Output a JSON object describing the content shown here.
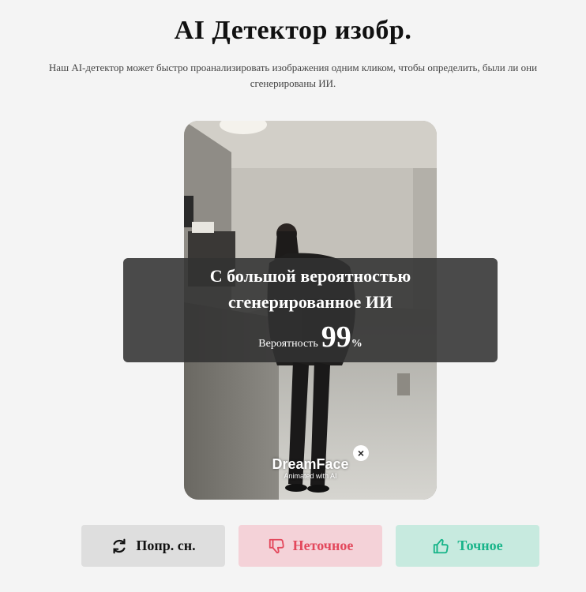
{
  "header": {
    "title": "AI Детектор изобр.",
    "subtitle": "Наш AI-детектор может быстро проанализировать изображения одним кликом, чтобы определить, были ли они сгенерированы ИИ."
  },
  "result": {
    "verdict_line1": "С большой вероятностью",
    "verdict_line2": "сгенерированное ИИ",
    "probability_label": "Вероятность",
    "probability_value": "99",
    "probability_unit": "%"
  },
  "watermark": {
    "brand": "DreamFace",
    "tagline": "Animated with AI",
    "close_icon": "×"
  },
  "actions": {
    "retry_label": "Попр. сн.",
    "retry_icon": "refresh-icon",
    "inaccurate_label": "Неточное",
    "inaccurate_icon": "thumbs-down-icon",
    "accurate_label": "Точное",
    "accurate_icon": "thumbs-up-icon"
  },
  "colors": {
    "inaccurate_text": "#e3485c",
    "inaccurate_bg": "#f4d2d8",
    "accurate_text": "#17b489",
    "accurate_bg": "#c7eadf",
    "retry_bg": "#dedede"
  }
}
